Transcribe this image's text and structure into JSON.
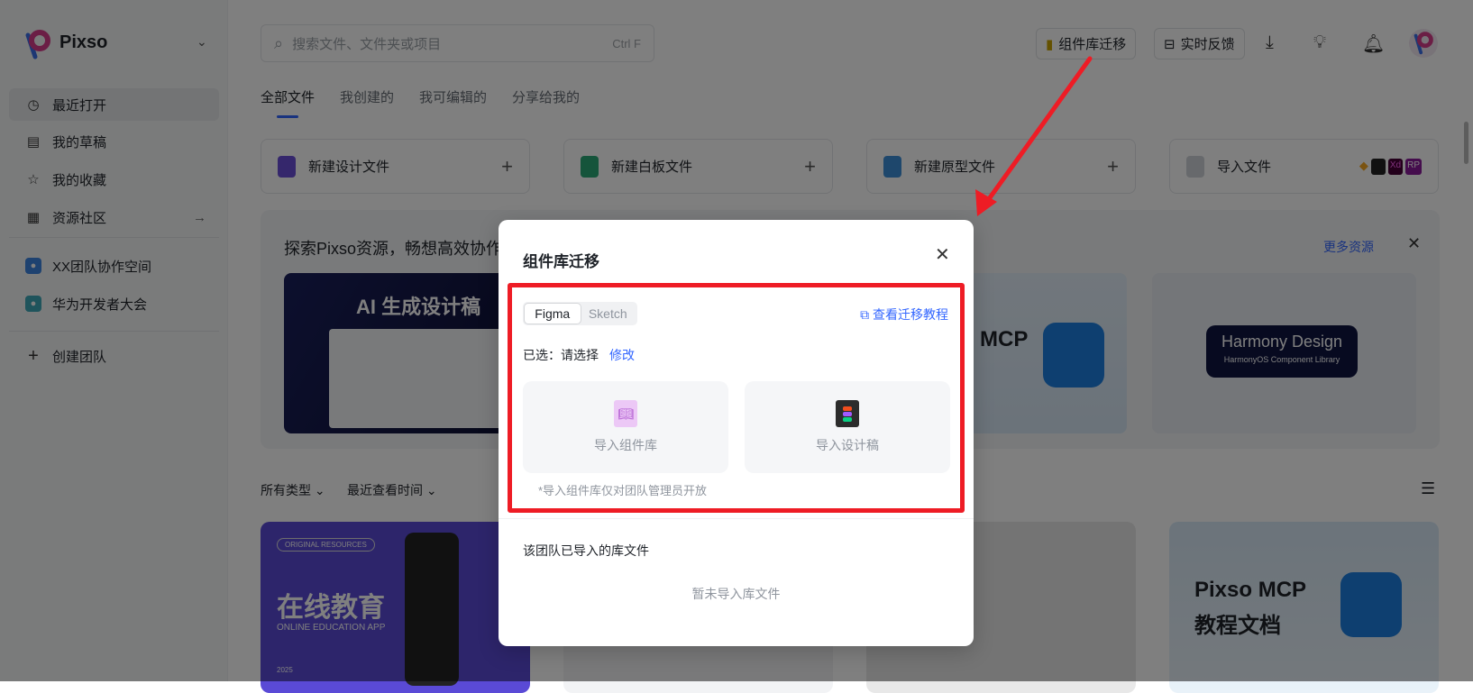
{
  "app": {
    "brand": "Pixso"
  },
  "sidebar": {
    "items": [
      {
        "label": "最近打开",
        "icon": "clock-icon"
      },
      {
        "label": "我的草稿",
        "icon": "draft-icon"
      },
      {
        "label": "我的收藏",
        "icon": "star-icon"
      },
      {
        "label": "资源社区",
        "icon": "grid-icon"
      }
    ],
    "teams": [
      {
        "label": "XX团队协作空间"
      },
      {
        "label": "华为开发者大会"
      }
    ],
    "create_team": "创建团队"
  },
  "search": {
    "placeholder": "搜索文件、文件夹或项目",
    "shortcut": "Ctrl F"
  },
  "topbar": {
    "migrate": "组件库迁移",
    "feedback": "实时反馈"
  },
  "tabs": [
    "全部文件",
    "我创建的",
    "我可编辑的",
    "分享给我的"
  ],
  "quick": [
    {
      "label": "新建设计文件",
      "color": "#6b4fd8"
    },
    {
      "label": "新建白板文件",
      "color": "#2aa876"
    },
    {
      "label": "新建原型文件",
      "color": "#3d8fd8"
    },
    {
      "label": "导入文件",
      "color": "#cfd3d8"
    }
  ],
  "import_formats": [
    "Xd",
    "RP"
  ],
  "banner": {
    "title": "探索Pixso资源，畅想高效协作",
    "more": "更多资源",
    "cards": [
      "AI 生成设计稿",
      "MCP",
      "Harmony Design",
      "HarmonyOS Component Library"
    ]
  },
  "filters": {
    "type": "所有类型",
    "sort": "最近查看时间"
  },
  "files": [
    {
      "title": "在线教育",
      "subtitle": "ONLINE EDUCATION APP",
      "tag": "ORIGINAL RESOURCES",
      "year": "2025"
    },
    {
      "title": ""
    },
    {
      "title": ""
    },
    {
      "title": "Pixso MCP",
      "subtitle": "教程文档"
    }
  ],
  "modal": {
    "title": "组件库迁移",
    "sources": [
      "Figma",
      "Sketch"
    ],
    "tutorial": "查看迁移教程",
    "selected_label": "已选：请选择",
    "modify": "修改",
    "options": [
      "导入组件库",
      "导入设计稿"
    ],
    "note": "*导入组件库仅对团队管理员开放",
    "imported_title": "该团队已导入的库文件",
    "empty": "暂未导入库文件"
  },
  "colors": {
    "accent": "#3366ff",
    "annotation": "#ee1c25"
  }
}
